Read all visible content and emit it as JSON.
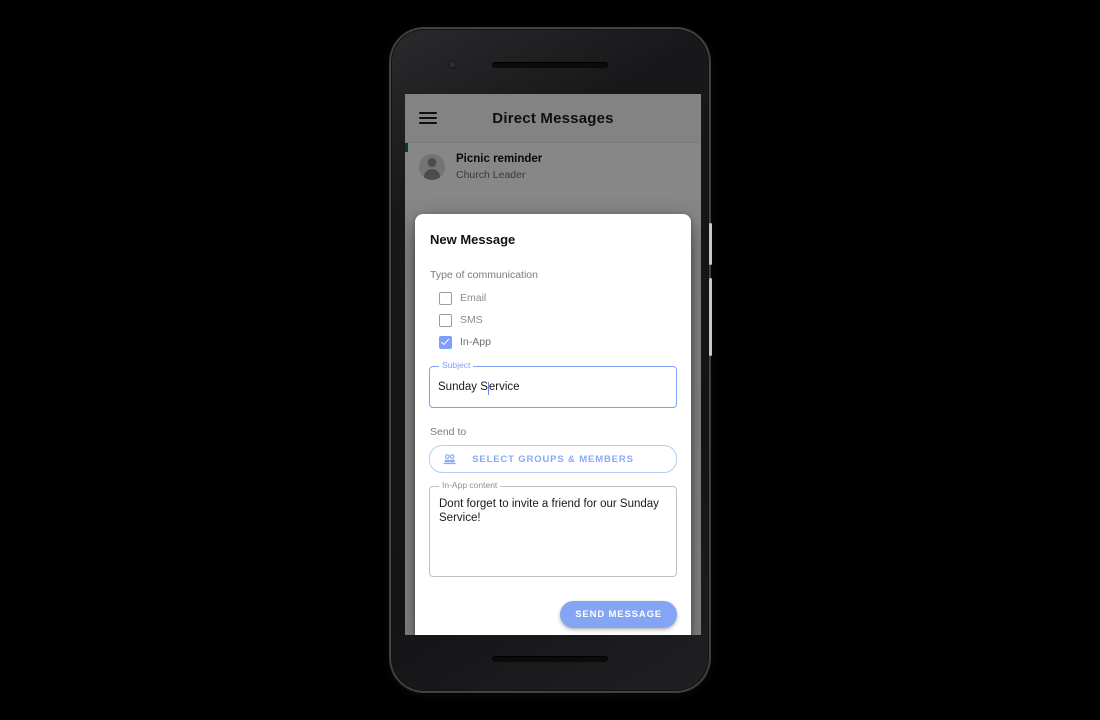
{
  "canvas": {
    "background": "#000000"
  },
  "device": {
    "name": "android-phone-mockup",
    "camera_icon": "camera-icon",
    "earpiece_icon": "earpiece-speaker",
    "bottom_speaker_icon": "bottom-speaker",
    "power_button": "power-button",
    "volume_button": "volume-button"
  },
  "app": {
    "header": {
      "menu_icon": "hamburger-menu-icon",
      "title": "Direct Messages"
    },
    "conversations": [
      {
        "avatar_icon": "person-avatar-icon",
        "title": "Picnic reminder",
        "subtitle": "Church Leader"
      }
    ]
  },
  "dialog": {
    "title": "New Message",
    "comm_type": {
      "label": "Type of communication",
      "options": [
        {
          "label": "Email",
          "checked": false
        },
        {
          "label": "SMS",
          "checked": false
        },
        {
          "label": "In-App",
          "checked": true
        }
      ]
    },
    "subject": {
      "legend": "Subject",
      "value": "Sunday S",
      "value_rest": "ervice",
      "full_value": "Sunday Service",
      "placeholder": "Subject",
      "focused": true
    },
    "send_to": {
      "label": "Send to",
      "button_label": "SELECT GROUPS & MEMBERS",
      "button_icon": "group-people-icon"
    },
    "content": {
      "legend": "In-App content",
      "value": "Dont forget to invite a friend for our Sunday Service!",
      "placeholder": "In-App content",
      "focused": false
    },
    "send_button_label": "SEND MESSAGE"
  },
  "colors": {
    "accent_blue": "#84a4f4",
    "checkbox_blue": "#7e9ff5",
    "outline_gray": "#c2c2c2",
    "app_accent_teal": "#0f6b63",
    "scrim": "rgba(0,0,0,0.46)"
  }
}
